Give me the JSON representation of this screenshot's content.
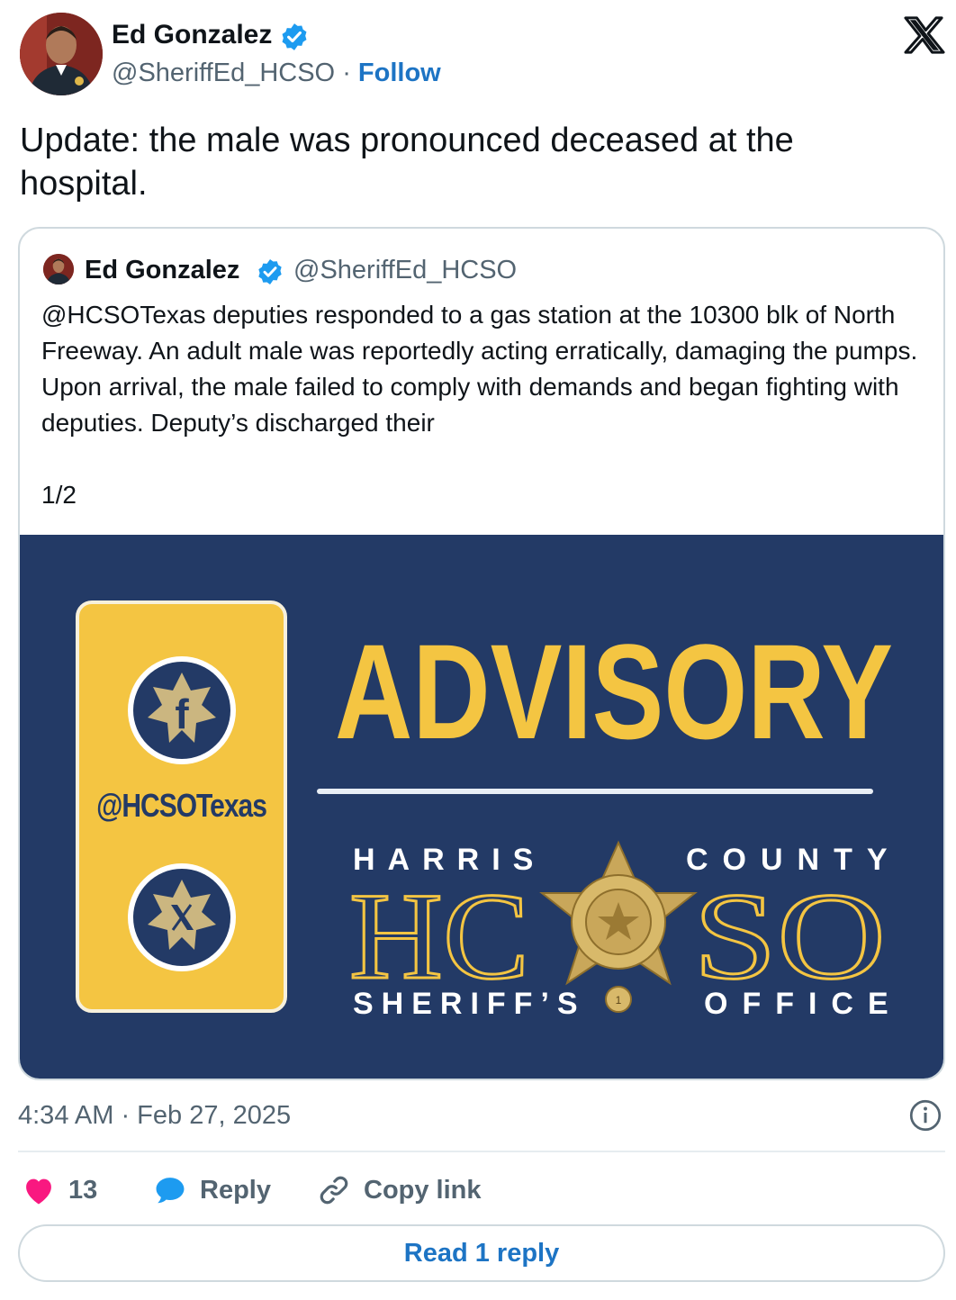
{
  "tweet": {
    "author_name": "Ed Gonzalez",
    "author_handle": "@SheriffEd_HCSO",
    "separator": "·",
    "follow_label": "Follow",
    "text": "Update: the male was pronounced deceased at the hospital.",
    "timestamp": "4:34 AM · Feb 27, 2025"
  },
  "quote": {
    "author_name": "Ed Gonzalez",
    "author_handle": "@SheriffEd_HCSO",
    "text": "@HCSOTexas deputies responded to a gas station at the 10300 blk of North Freeway. An adult male was reportedly acting erratically, damaging the pumps. Upon arrival, the male failed to comply with demands and began fighting with deputies. Deputy’s discharged their",
    "page_indicator": "1/2"
  },
  "media": {
    "headline": "ADVISORY",
    "social_handle": "@HCSOTexas",
    "line_top_left": "HARRIS",
    "line_top_right": "COUNTY",
    "big_left": "HC",
    "big_right": "SO",
    "line_bottom_left": "SHERIFF’S",
    "line_bottom_right": "OFFICE",
    "badge_text": "SHERIFF HARRIS COUNTY SHERIFF'S OFFICE THE STATE OF TEXAS",
    "colors": {
      "navy": "#233a66",
      "gold": "#f4c542"
    }
  },
  "actions": {
    "like_count": "13",
    "reply_label": "Reply",
    "copy_link_label": "Copy link",
    "read_replies_label": "Read 1 reply"
  },
  "icons": {
    "verified": "verified-badge-icon",
    "x_logo": "x-logo-icon",
    "info": "info-icon",
    "like": "heart-icon",
    "reply": "speech-bubble-icon",
    "copy": "link-icon",
    "facebook": "facebook-icon",
    "x_social": "x-social-icon"
  },
  "colors": {
    "link": "#1d74c4",
    "like": "#f91880",
    "reply": "#1d9bf0",
    "muted": "#536471"
  }
}
